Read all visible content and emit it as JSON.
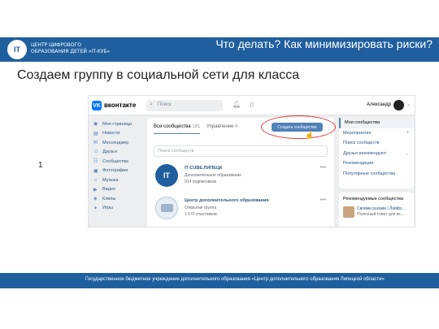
{
  "header": {
    "logo_text": "IT",
    "org_line1": "ЦЕНТР ЦИФРОВОГО",
    "org_line2": "ОБРАЗОВАНИЯ ДЕТЕЙ «IT-КУБ»",
    "slide_title": "Что делать? Как минимизировать риски?"
  },
  "subtitle": "Создаем группу в социальной сети для класса",
  "step_number": "1",
  "vk": {
    "brand": "вконтакте",
    "logo": "VK",
    "search_placeholder": "Поиск",
    "user_name": "Александр",
    "menu": [
      {
        "icon": "user-icon",
        "glyph": "◉",
        "label": "Моя страница"
      },
      {
        "icon": "news-icon",
        "glyph": "▤",
        "label": "Новости"
      },
      {
        "icon": "messenger-icon",
        "glyph": "✉",
        "label": "Мессенджер"
      },
      {
        "icon": "friends-icon",
        "glyph": "☺",
        "label": "Друзья"
      },
      {
        "icon": "communities-icon",
        "glyph": "☷",
        "label": "Сообщества"
      },
      {
        "icon": "photos-icon",
        "glyph": "▣",
        "label": "Фотографии"
      },
      {
        "icon": "music-icon",
        "glyph": "♫",
        "label": "Музыка"
      },
      {
        "icon": "video-icon",
        "glyph": "▶",
        "label": "Видео"
      },
      {
        "icon": "clips-icon",
        "glyph": "◈",
        "label": "Клипы"
      },
      {
        "icon": "games-icon",
        "glyph": "✦",
        "label": "Игры"
      }
    ],
    "tabs": {
      "all_label": "Все сообщества",
      "all_count": "181",
      "manage_label": "Управление",
      "manage_count": "4"
    },
    "create_button": "Создать сообщество",
    "groups_search_placeholder": "Поиск сообществ",
    "groups": [
      {
        "avatar": "IT",
        "name": "IT-CUBE.ЛИПЕЦК",
        "type": "Дополнительное образование",
        "subscribers": "914 подписчиков"
      },
      {
        "avatar": "",
        "name": "Центр дополнительного образования",
        "type": "Открытая группа",
        "subscribers": "1 670 участников"
      }
    ],
    "side_menu": [
      {
        "label": "Мои сообщества",
        "active": true,
        "extra": ""
      },
      {
        "label": "Мероприятия",
        "active": false,
        "extra": "+"
      },
      {
        "label": "Поиск сообществ",
        "active": false,
        "extra": ""
      },
      {
        "label": "Друзья рекомендуют",
        "active": false,
        "extra": "⌄"
      },
      {
        "label": "Рекомендации",
        "active": false,
        "extra": ""
      },
      {
        "label": "Популярные сообщества",
        "active": false,
        "extra": ""
      }
    ],
    "recommended": {
      "title": "Рекомендуемые сообщества",
      "name": "Своими руками | Лайфх...",
      "desc": "Полезный совет для вс..."
    }
  },
  "footer": "Государственное бюджетное учреждение дополнительного образования «Центр дополнительного образования Липецкой области»"
}
